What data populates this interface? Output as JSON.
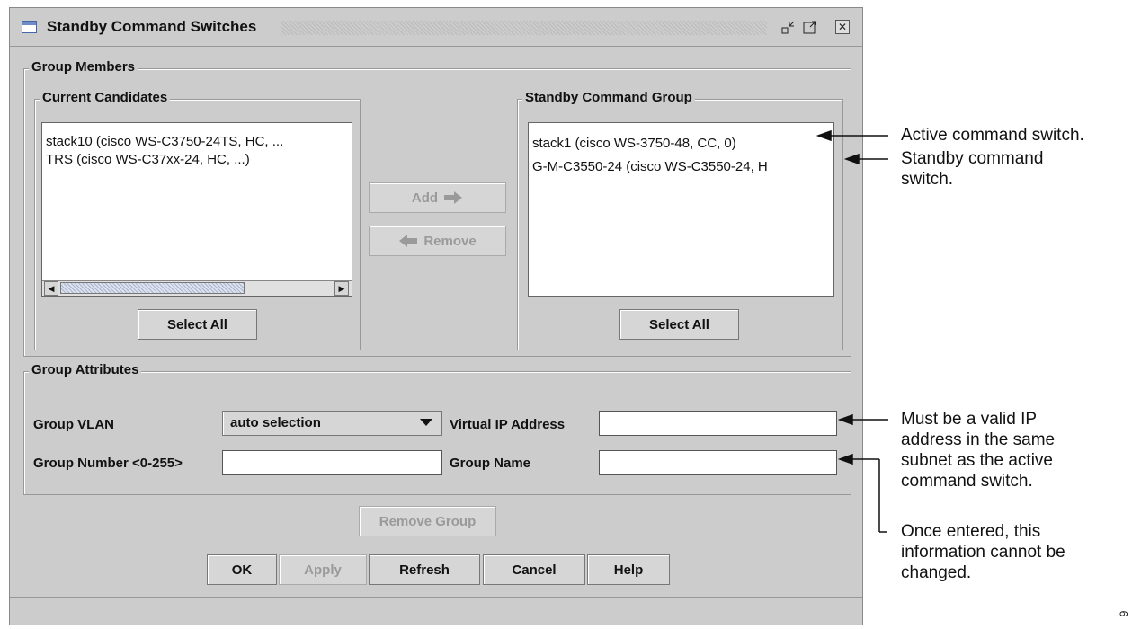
{
  "window": {
    "title": "Standby Command Switches",
    "title_icon": "window-icon",
    "controls": [
      "minimize-icon",
      "maximize-icon",
      "close-icon"
    ]
  },
  "group_members": {
    "legend": "Group Members",
    "current_candidates": {
      "legend": "Current Candidates",
      "items": [
        "stack10 (cisco WS-C3750-24TS, HC, ...",
        "TRS (cisco WS-C37xx-24, HC, ...)"
      ],
      "select_all": "Select All"
    },
    "add_label": "Add",
    "remove_label": "Remove",
    "standby_group": {
      "legend": "Standby Command Group",
      "items": [
        "stack1 (cisco WS-3750-48, CC, 0)",
        "G-M-C3550-24 (cisco WS-C3550-24, H"
      ],
      "select_all": "Select All"
    }
  },
  "group_attributes": {
    "legend": "Group Attributes",
    "vlan_label": "Group VLAN",
    "vlan_value": "auto selection",
    "virtual_ip_label": "Virtual IP Address",
    "virtual_ip_value": "",
    "group_number_label": "Group Number <0-255>",
    "group_number_value": "",
    "group_name_label": "Group Name",
    "group_name_value": ""
  },
  "buttons": {
    "remove_group": "Remove Group",
    "ok": "OK",
    "apply": "Apply",
    "refresh": "Refresh",
    "cancel": "Cancel",
    "help": "Help"
  },
  "annotations": {
    "active": "Active command switch.",
    "standby_line1": "Standby command",
    "standby_line2": "switch.",
    "ip_line1": "Must be a valid IP",
    "ip_line2": "address in the same",
    "ip_line3": "subnet as the active",
    "ip_line4": "command switch.",
    "entered_line1": "Once entered, this",
    "entered_line2": "information cannot be",
    "entered_line3": "changed."
  },
  "figure_number": "6"
}
